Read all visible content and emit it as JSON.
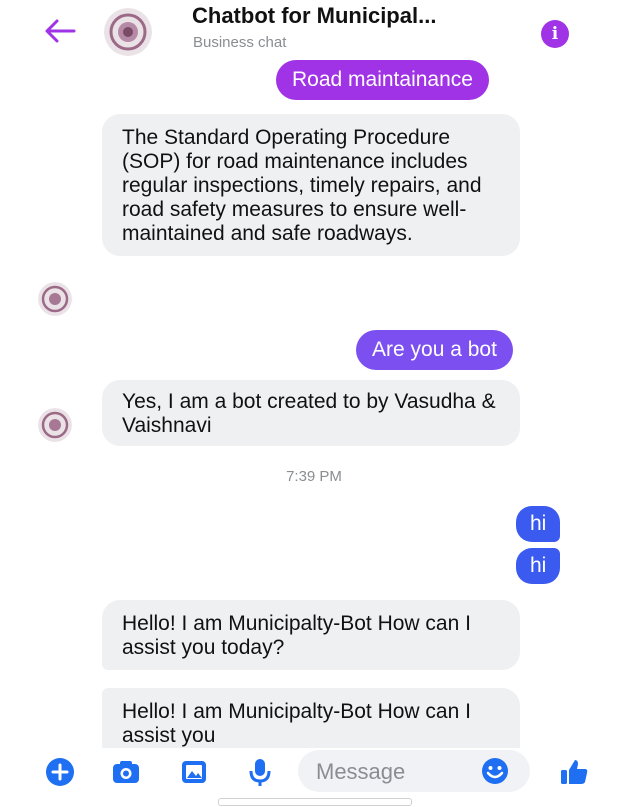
{
  "header": {
    "title": "Chatbot for Municipal...",
    "subtitle": "Business chat",
    "info_label": "i"
  },
  "colors": {
    "accent_purple": "#a033e6",
    "accent_blue": "#3b5bf0",
    "incoming_bg": "#eef0f2"
  },
  "messages": [
    {
      "from": "user",
      "text": "Road maintainance"
    },
    {
      "from": "bot",
      "text": "The Standard Operating Procedure (SOP) for road maintenance includes regular inspections, timely repairs, and road safety measures to ensure well-maintained and safe roadways."
    },
    {
      "from": "user",
      "text": "Are you a bot"
    },
    {
      "from": "bot",
      "text": "Yes, I am a bot created to by Vasudha & Vaishnavi"
    },
    {
      "from": "user",
      "text": "hi"
    },
    {
      "from": "user",
      "text": "hi"
    },
    {
      "from": "bot",
      "text": "Hello! I am Municipalty-Bot How can I assist you today?"
    },
    {
      "from": "bot",
      "text": "Hello! I am Municipalty-Bot How can I assist you"
    }
  ],
  "timestamp": "7:39 PM",
  "composer": {
    "placeholder": "Message",
    "icons": [
      "plus-icon",
      "camera-icon",
      "gallery-icon",
      "microphone-icon",
      "emoji-icon",
      "thumbs-up-icon"
    ]
  }
}
